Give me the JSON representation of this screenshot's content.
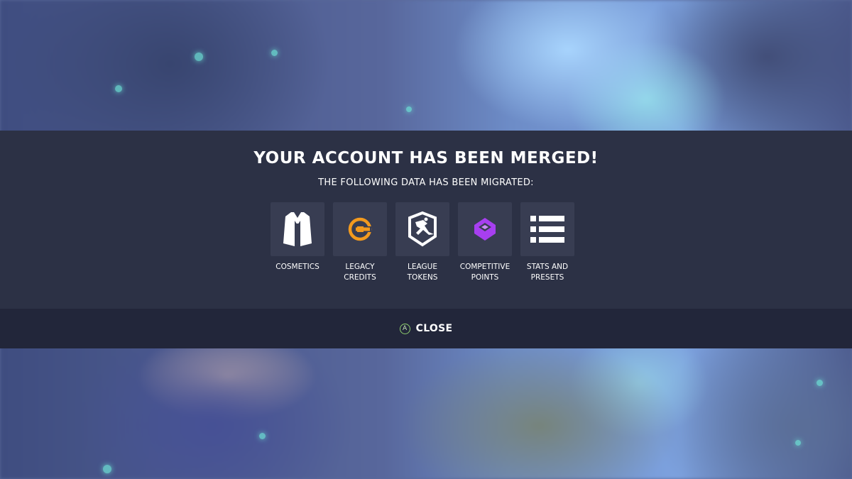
{
  "dialog": {
    "title": "YOUR ACCOUNT HAS BEEN MERGED!",
    "subtitle": "THE FOLLOWING DATA HAS BEEN MIGRATED:",
    "items": [
      {
        "label": "COSMETICS",
        "icon": "jacket-icon",
        "color": "#ffffff"
      },
      {
        "label": "LEGACY\nCREDITS",
        "icon": "legacy-credits-icon",
        "color": "#f39a1e"
      },
      {
        "label": "LEAGUE\nTOKENS",
        "icon": "league-tokens-icon",
        "color": "#ffffff"
      },
      {
        "label": "COMPETITIVE\nPOINTS",
        "icon": "competitive-points-icon",
        "color": "#a73ff0"
      },
      {
        "label": "STATS AND\nPRESETS",
        "icon": "list-icon",
        "color": "#ffffff"
      }
    ]
  },
  "footer": {
    "button_glyph": "A",
    "close_label": "CLOSE",
    "button_color": "#8fcf6e"
  }
}
